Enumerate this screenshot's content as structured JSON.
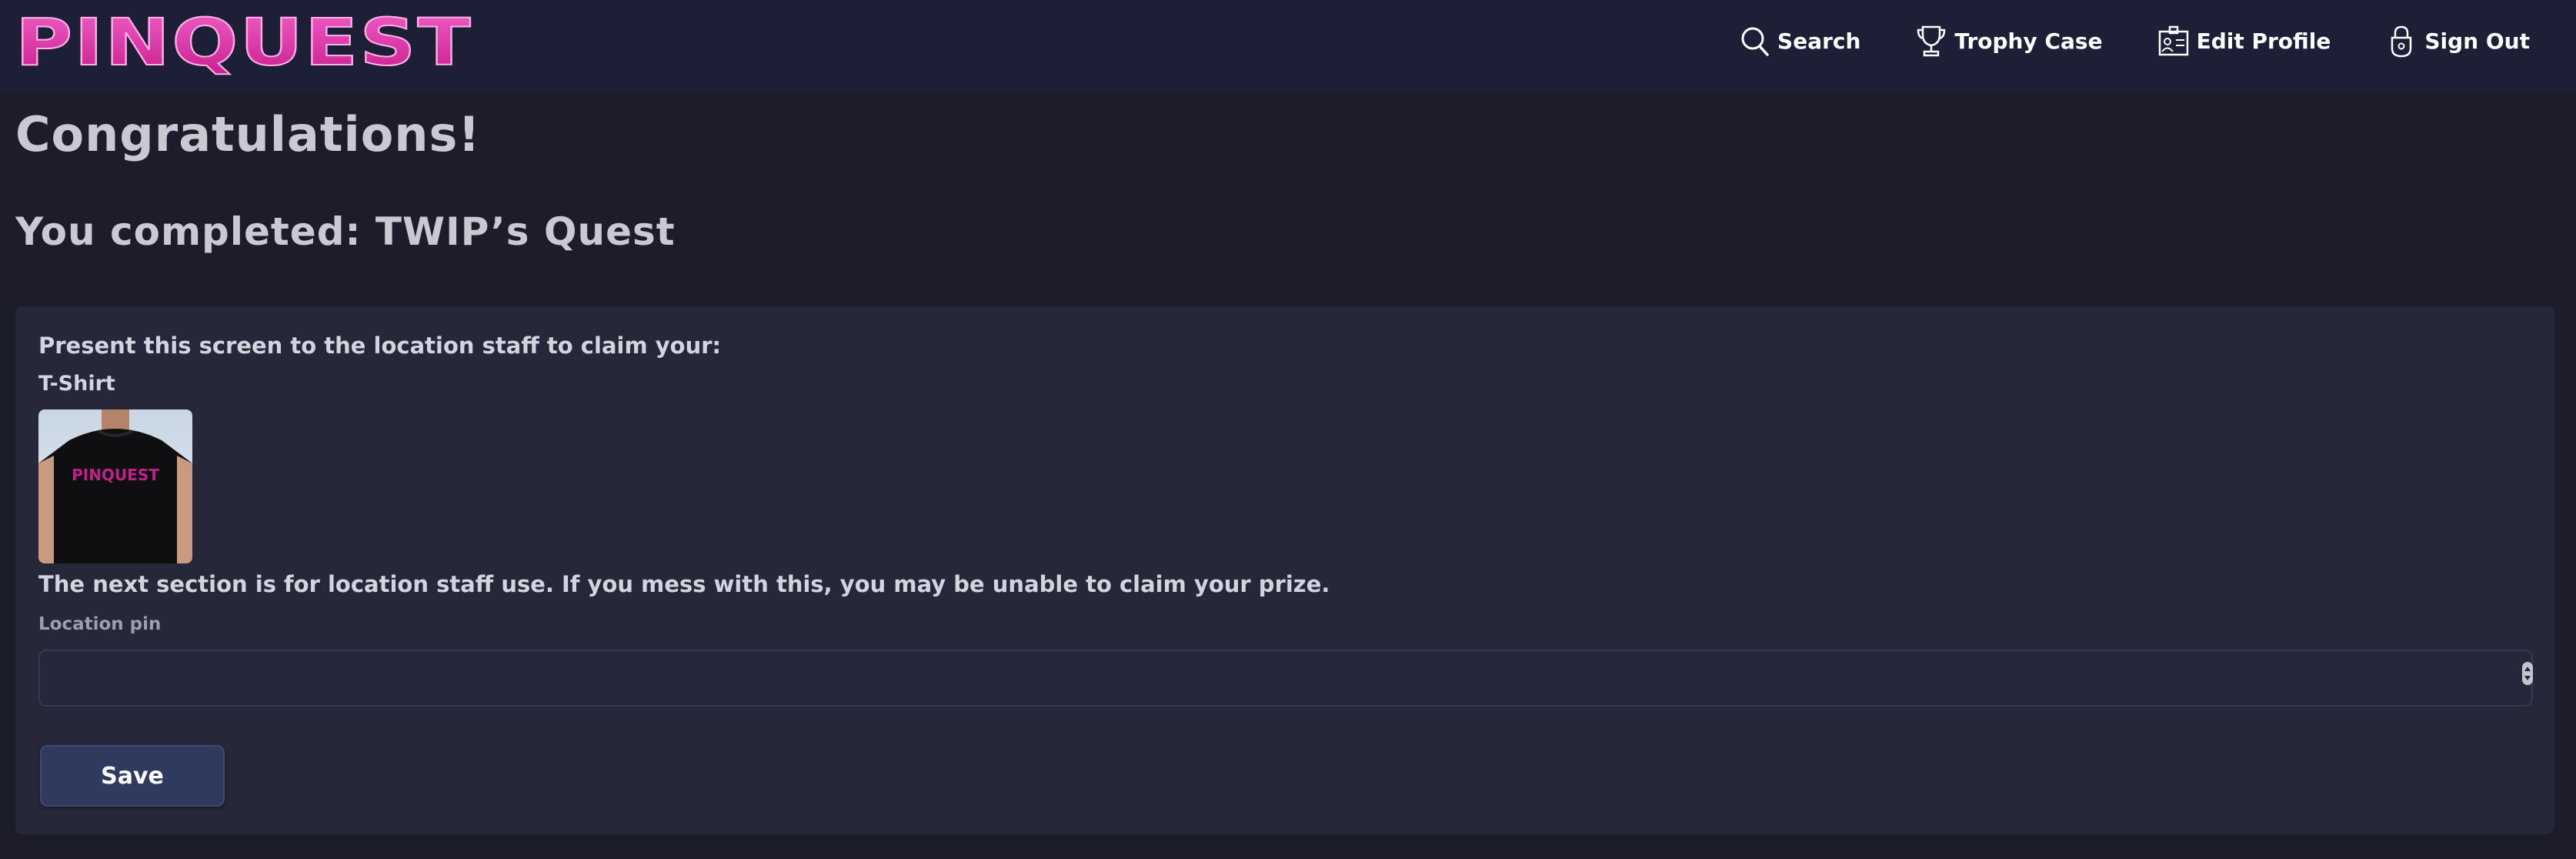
{
  "brand": {
    "logo_text": "PINQUEST",
    "accent_color": "#e040b0"
  },
  "nav": {
    "items": [
      {
        "label": "Search",
        "icon": "search-icon"
      },
      {
        "label": "Trophy Case",
        "icon": "trophy-icon"
      },
      {
        "label": "Edit Profile",
        "icon": "id-card-icon"
      },
      {
        "label": "Sign Out",
        "icon": "lock-icon"
      }
    ]
  },
  "page": {
    "title": "Congratulations!",
    "subtitle": "You completed: TWIP’s Quest"
  },
  "card": {
    "claim_text": "Present this screen to the location staff to claim your:",
    "prize_name": "T-Shirt",
    "prize_image_text": "PINQUEST",
    "warning_text": "The next section is for location staff use. If you mess with this, you may be unable to claim your prize.",
    "pin_label": "Location pin",
    "pin_value": "",
    "pin_placeholder": "",
    "save_label": "Save"
  }
}
